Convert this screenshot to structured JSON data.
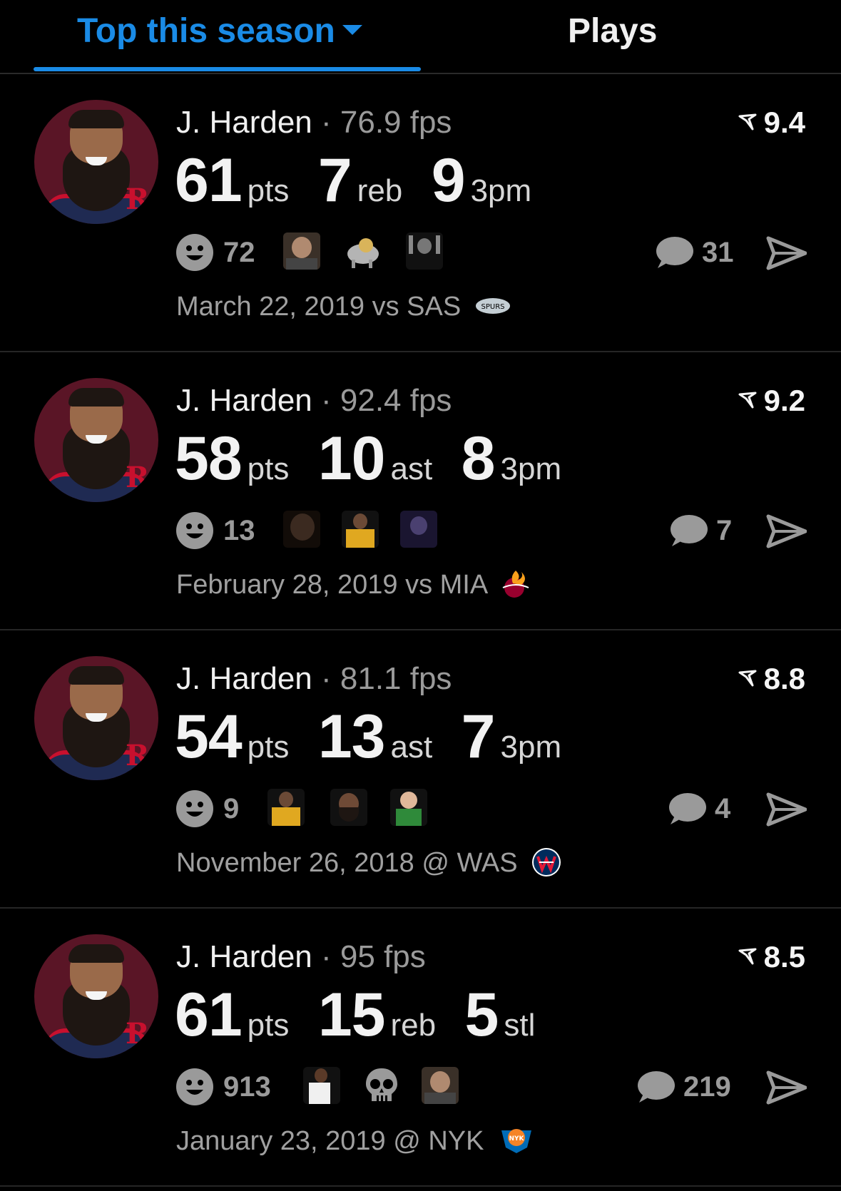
{
  "tabs": {
    "top_label": "Top this season",
    "plays_label": "Plays"
  },
  "cards": [
    {
      "player": "J. Harden",
      "fps": "· 76.9 fps",
      "score": "9.4",
      "stats": [
        {
          "num": "61",
          "label": "pts"
        },
        {
          "num": "7",
          "label": "reb"
        },
        {
          "num": "9",
          "label": "3pm"
        }
      ],
      "reaction_count": "72",
      "comment_count": "31",
      "date": "March 22, 2019 vs SAS",
      "team_logo": "spurs-logo"
    },
    {
      "player": "J. Harden",
      "fps": "· 92.4 fps",
      "score": "9.2",
      "stats": [
        {
          "num": "58",
          "label": "pts"
        },
        {
          "num": "10",
          "label": "ast"
        },
        {
          "num": "8",
          "label": "3pm"
        }
      ],
      "reaction_count": "13",
      "comment_count": "7",
      "date": "February 28, 2019 vs MIA",
      "team_logo": "heat-logo"
    },
    {
      "player": "J. Harden",
      "fps": "· 81.1 fps",
      "score": "8.8",
      "stats": [
        {
          "num": "54",
          "label": "pts"
        },
        {
          "num": "13",
          "label": "ast"
        },
        {
          "num": "7",
          "label": "3pm"
        }
      ],
      "reaction_count": "9",
      "comment_count": "4",
      "date": "November 26, 2018 @ WAS",
      "team_logo": "wizards-logo"
    },
    {
      "player": "J. Harden",
      "fps": "· 95 fps",
      "score": "8.5",
      "stats": [
        {
          "num": "61",
          "label": "pts"
        },
        {
          "num": "15",
          "label": "reb"
        },
        {
          "num": "5",
          "label": "stl"
        }
      ],
      "reaction_count": "913",
      "comment_count": "219",
      "date": "January 23, 2019 @ NYK",
      "team_logo": "knicks-logo"
    }
  ],
  "colors": {
    "accent": "#1a8be6",
    "background": "#000000",
    "muted": "#9a9a9a"
  }
}
